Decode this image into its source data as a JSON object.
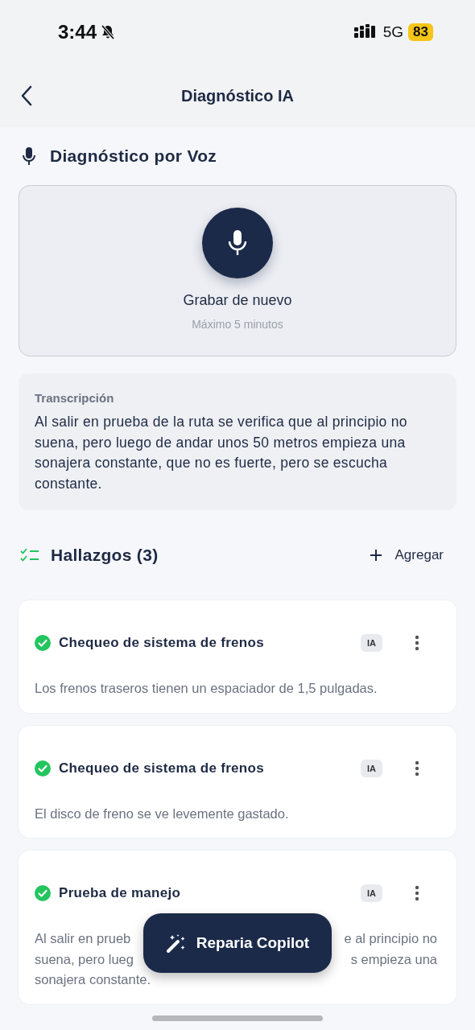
{
  "status_bar": {
    "time": "3:44",
    "network": "5G",
    "battery": "83"
  },
  "header": {
    "title": "Diagnóstico IA"
  },
  "voice": {
    "title": "Diagnóstico por Voz",
    "record_label": "Grabar de nuevo",
    "hint": "Máximo 5 minutos"
  },
  "transcription": {
    "label": "Transcripción",
    "text": "Al salir en prueba de la ruta se verifica que al principio no suena, pero luego de andar unos 50 metros empieza una sonajera constante, que no es fuerte, pero se escucha constante."
  },
  "findings": {
    "title": "Hallazgos (3)",
    "add_label": "Agregar",
    "items": [
      {
        "title": "Chequeo de sistema de frenos",
        "verified": true,
        "badge": "IA",
        "description_lines": [
          [
            "Los frenos traseros tienen un espaciador de 1,5 pulgadas."
          ]
        ]
      },
      {
        "title": "Chequeo de sistema de frenos",
        "verified": true,
        "badge": "IA",
        "description_lines": [
          [
            "El disco de freno se ve levemente gastado."
          ]
        ]
      },
      {
        "title": "Prueba de manejo",
        "verified": true,
        "badge": "IA",
        "description_lines": [
          [
            "Al salir en prueb",
            "e al principio no"
          ],
          [
            "suena, pero lueg",
            "s empieza una"
          ],
          [
            "sonajera constante."
          ]
        ]
      }
    ]
  },
  "copilot_button": {
    "label": "Reparia Copilot"
  }
}
